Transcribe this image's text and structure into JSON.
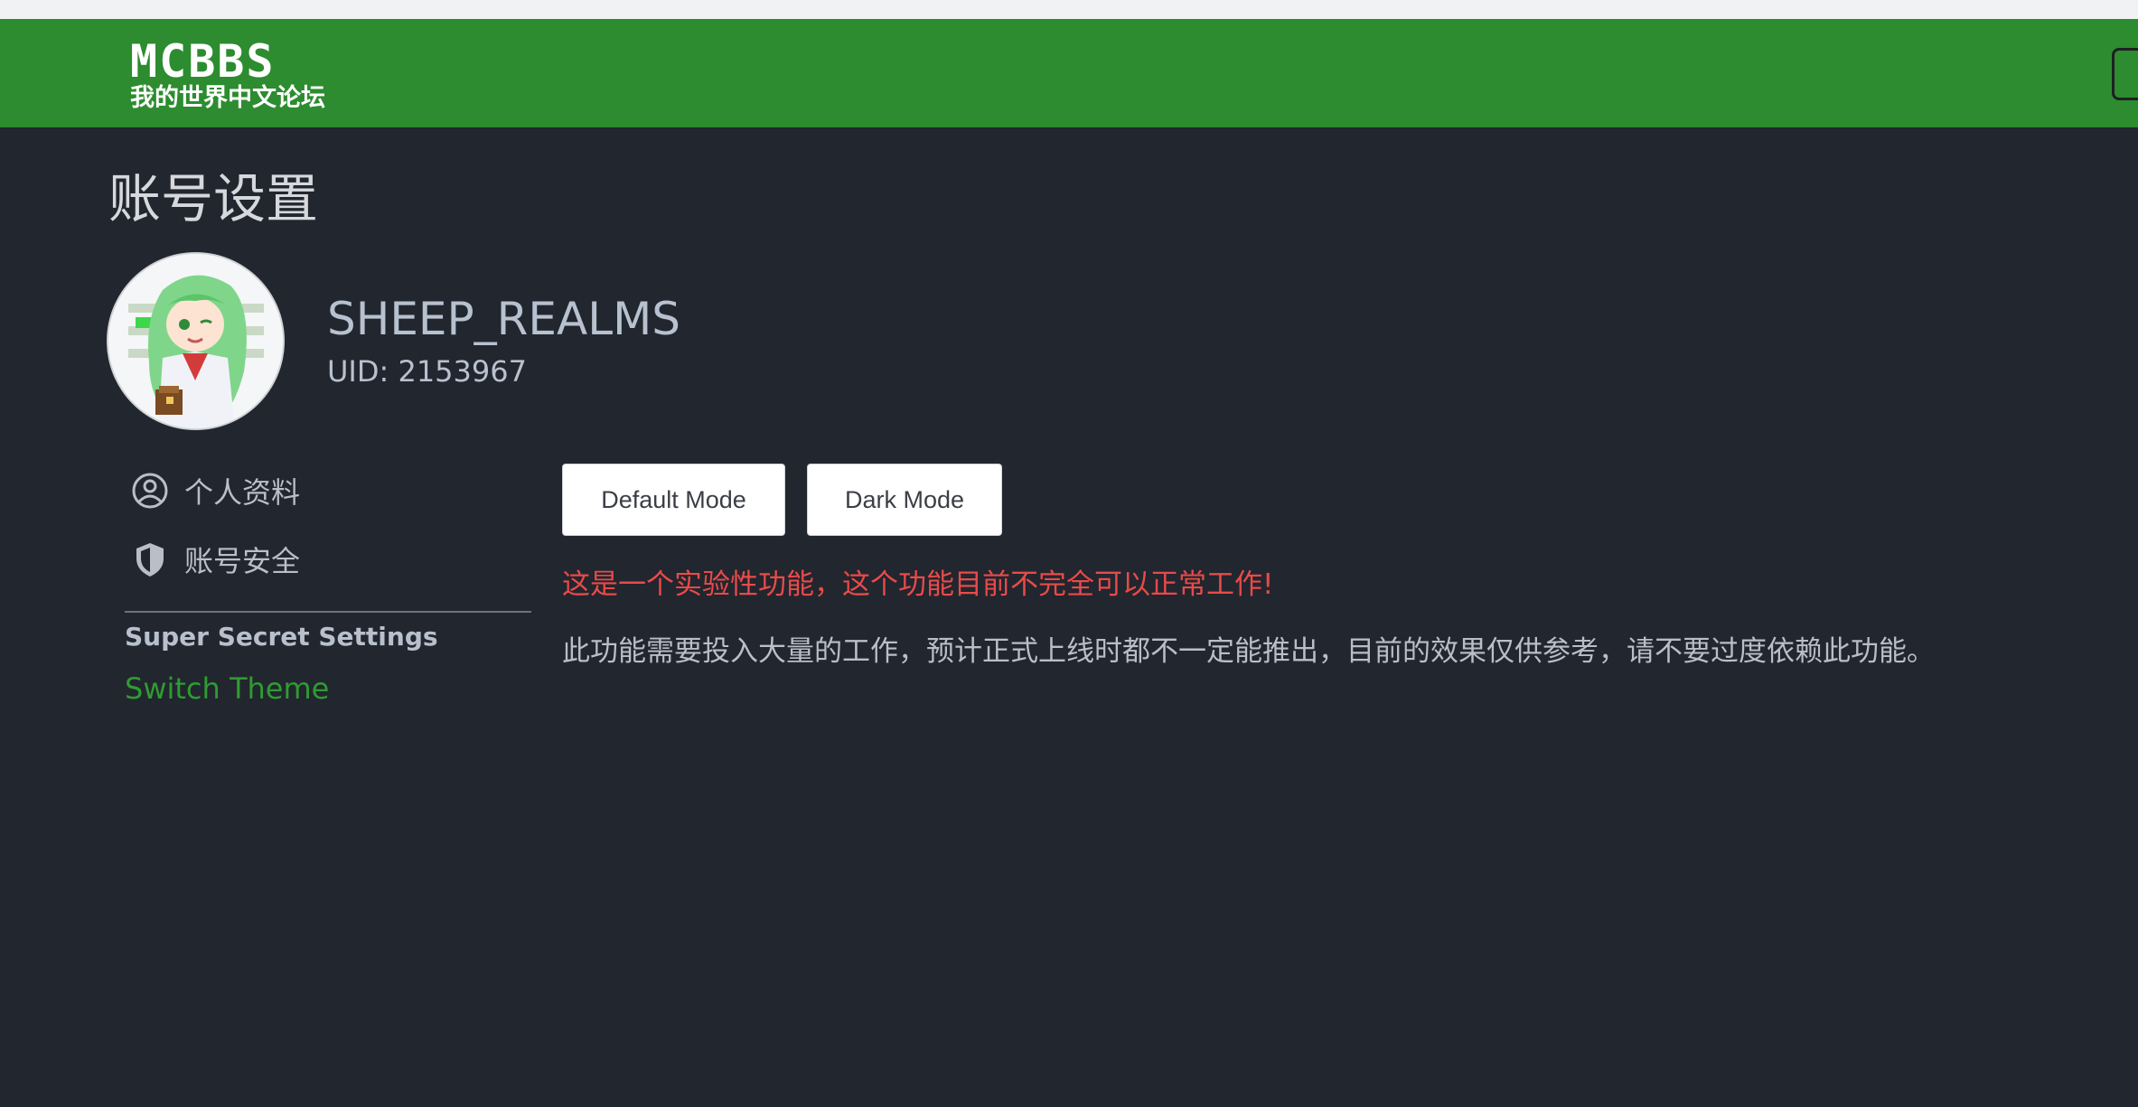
{
  "header": {
    "logo_text": "MCBBS",
    "logo_subtitle": "我的世界中文论坛"
  },
  "page": {
    "title": "账号设置"
  },
  "profile": {
    "username": "SHEEP_REALMS",
    "uid": "UID: 2153967"
  },
  "sidebar": {
    "items": [
      {
        "label": "个人资料",
        "icon": "user-circle-icon"
      },
      {
        "label": "账号安全",
        "icon": "shield-icon"
      }
    ],
    "secret_heading": "Super Secret Settings",
    "switch_theme": "Switch Theme"
  },
  "theme": {
    "buttons": [
      {
        "label": "Default Mode"
      },
      {
        "label": "Dark Mode"
      }
    ],
    "warning": "这是一个实验性功能，这个功能目前不完全可以正常工作!",
    "notice": "此功能需要投入大量的工作，预计正式上线时都不一定能推出，目前的效果仅供参考，请不要过度依赖此功能。"
  },
  "colors": {
    "header_bg": "#2c8c2f",
    "page_bg": "#22262e",
    "warning": "#e94a4a",
    "link": "#2f9b33"
  }
}
